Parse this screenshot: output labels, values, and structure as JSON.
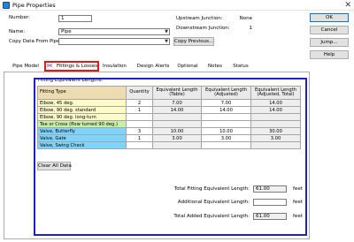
{
  "window": {
    "title": "Pipe Properties",
    "close_glyph": "✕"
  },
  "form": {
    "number_label": "Number:",
    "number_value": "1",
    "name_label": "Name:",
    "name_value": "Pipe",
    "copy_label": "Copy Data From Pipe...",
    "copy_value": "",
    "copy_previous_label": "Copy Previous..."
  },
  "junctions": {
    "upstream_label": "Upstream Junction:",
    "upstream_value": "None",
    "downstream_label": "Downstream Junction:",
    "downstream_value": "1"
  },
  "buttons": {
    "ok": "OK",
    "cancel": "Cancel",
    "jump": "Jump...",
    "help": "Help"
  },
  "tabs": [
    {
      "label": "Pipe Model"
    },
    {
      "label": "Fittings & Losses",
      "active": true
    },
    {
      "label": "Insulation"
    },
    {
      "label": "Design Alerts"
    },
    {
      "label": "Optional"
    },
    {
      "label": "Notes"
    },
    {
      "label": "Status"
    }
  ],
  "fittings": {
    "section_title": "Fitting Equivalent Lengths:",
    "columns": [
      "Fitting Type",
      "Quantity",
      "Equivalent Length (Table)",
      "Equivalent Length (Adjusted)",
      "Equivalent Length (Adjusted, Total)"
    ],
    "rows": [
      {
        "type": "Elbow, 45 deg.",
        "quantity": "2",
        "table": "7.00",
        "adjusted": "7.00",
        "total": "14.00",
        "color": "yellow"
      },
      {
        "type": "Elbow, 90 deg. standard",
        "quantity": "1",
        "table": "14.00",
        "adjusted": "14.00",
        "total": "14.00",
        "color": "yellow"
      },
      {
        "type": "Elbow, 90 deg. long-turn",
        "quantity": "",
        "table": "",
        "adjusted": "",
        "total": "",
        "color": "yellow"
      },
      {
        "type": "Tee or Cross (flow turned 90 deg.)",
        "quantity": "",
        "table": "",
        "adjusted": "",
        "total": "",
        "color": "green"
      },
      {
        "type": "Valve, Butterfly",
        "quantity": "3",
        "table": "10.00",
        "adjusted": "10.00",
        "total": "30.00",
        "color": "blue"
      },
      {
        "type": "Valve, Gate",
        "quantity": "1",
        "table": "3.00",
        "adjusted": "3.00",
        "total": "3.00",
        "color": "blue"
      },
      {
        "type": "Valve, Swing Check",
        "quantity": "",
        "table": "",
        "adjusted": "",
        "total": "",
        "color": "blue"
      }
    ],
    "clear_all_label": "Clear All Data",
    "total_fitting_label": "Total Fitting Equivalent Length:",
    "total_fitting_value": "61.00",
    "total_fitting_unit": "feet",
    "additional_label": "Additional Equivalent Length:",
    "additional_value": "",
    "additional_unit": "feet",
    "total_added_label": "Total Added Equivalent Length:",
    "total_added_value": "61.00",
    "total_added_unit": "feet"
  },
  "colors": {
    "active_tab_border": "#e0191a",
    "highlight_frame": "#1f24b8",
    "fitting_header": "#eddbb1",
    "elbow_row": "#fffbc6",
    "tee_row": "#c8f0a8",
    "valve_row": "#7ed4ff"
  }
}
